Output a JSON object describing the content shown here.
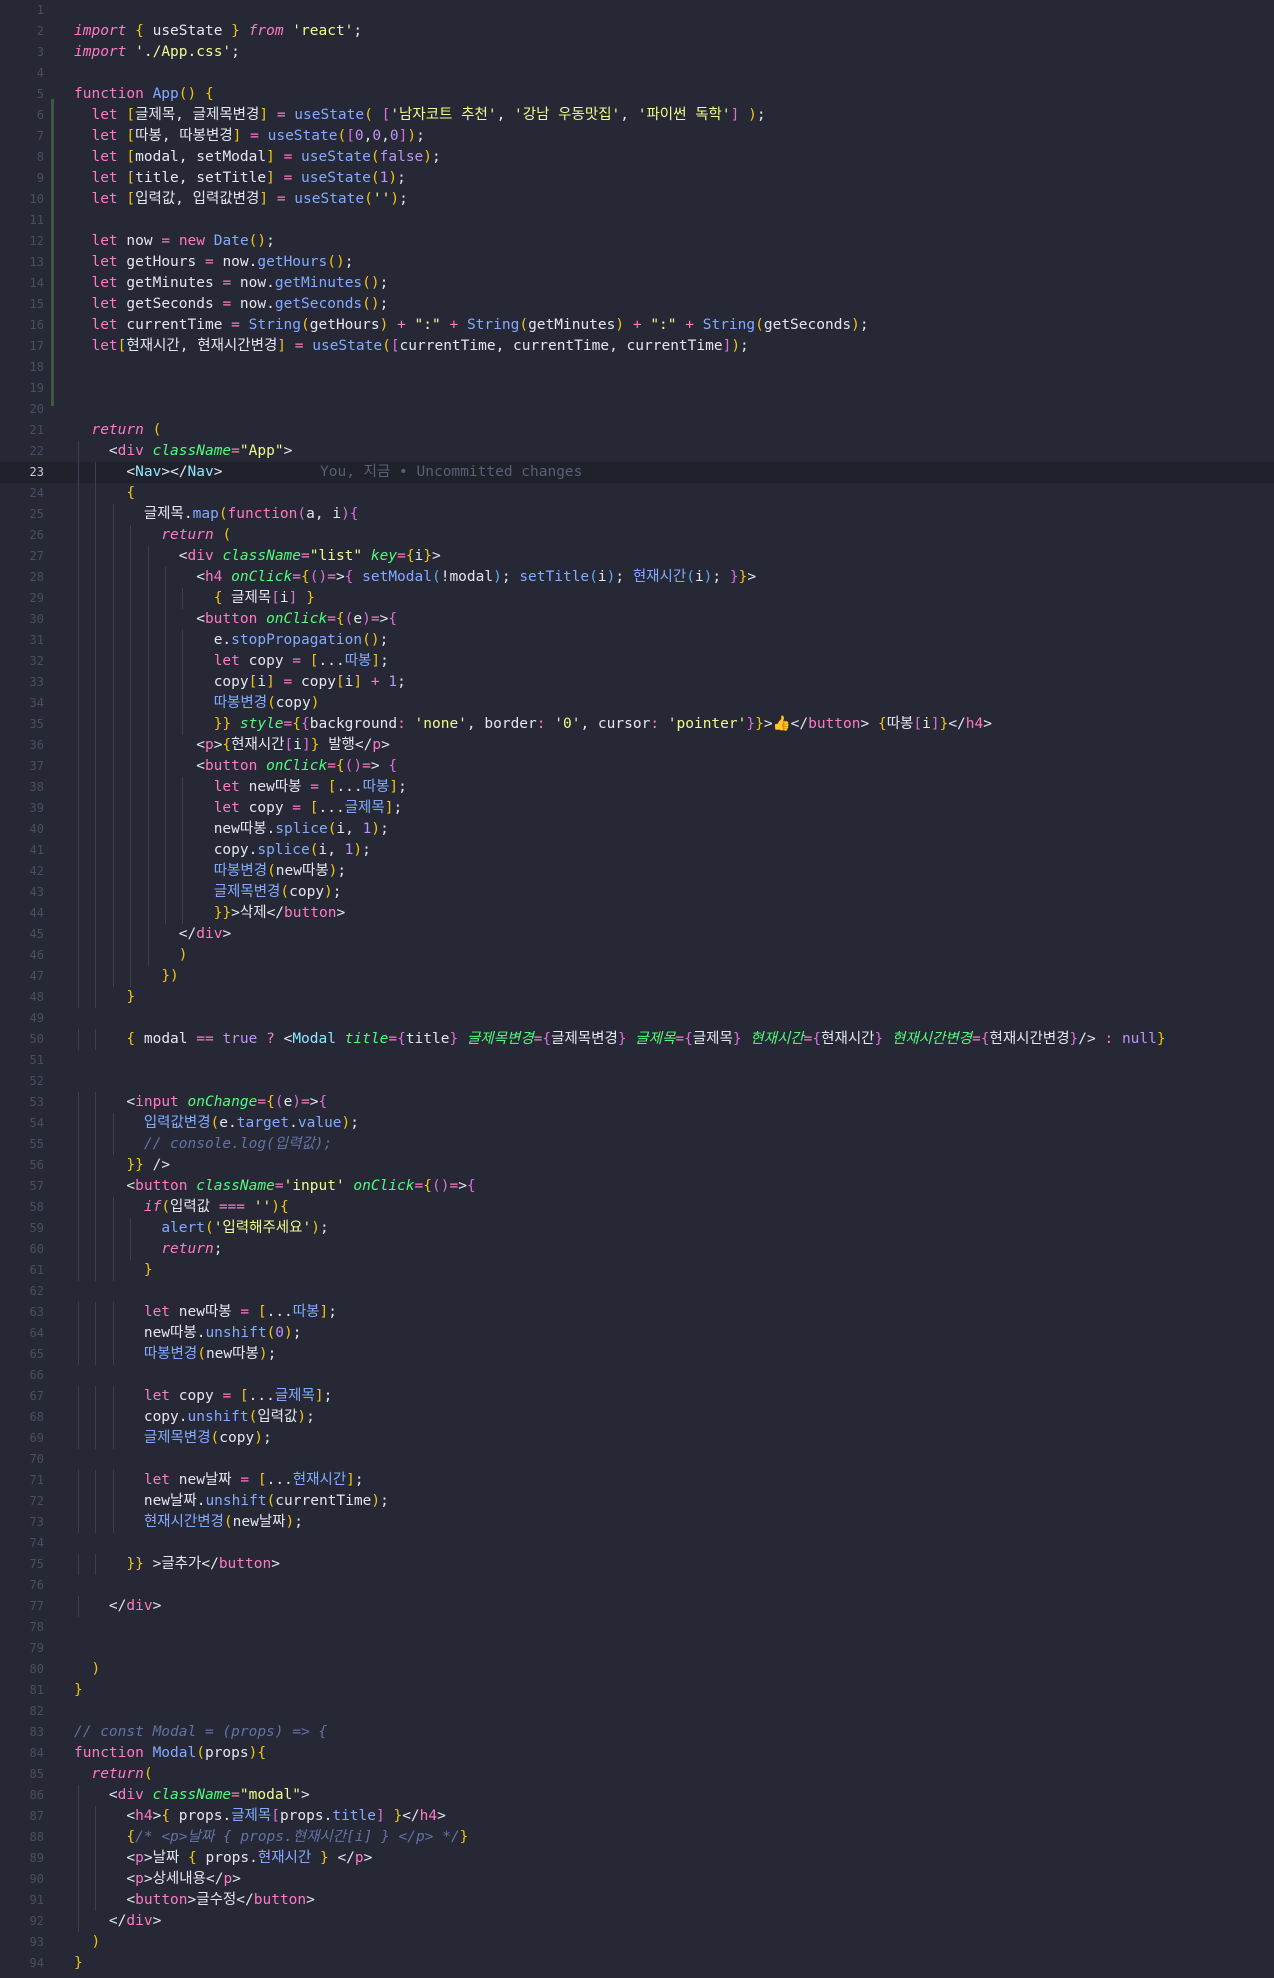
{
  "editor": {
    "active_line": 23,
    "blame": "You, 지금 • Uncommitted changes",
    "lines": [
      {
        "n": 1,
        "t": ""
      },
      {
        "n": 2,
        "t": "import { useState } from 'react';"
      },
      {
        "n": 3,
        "t": "import './App.css';"
      },
      {
        "n": 4,
        "t": ""
      },
      {
        "n": 5,
        "t": "function App() {"
      },
      {
        "n": 6,
        "t": "  let [글제목, 글제목변경] = useState( ['남자코트 추천', '강남 우동맛집', '파이썬 독학'] );"
      },
      {
        "n": 7,
        "t": "  let [따봉, 따봉변경] = useState([0,0,0]);"
      },
      {
        "n": 8,
        "t": "  let [modal, setModal] = useState(false);"
      },
      {
        "n": 9,
        "t": "  let [title, setTitle] = useState(1);"
      },
      {
        "n": 10,
        "t": "  let [입력값, 입력값변경] = useState('');"
      },
      {
        "n": 11,
        "t": ""
      },
      {
        "n": 12,
        "t": "  let now = new Date();"
      },
      {
        "n": 13,
        "t": "  let getHours = now.getHours();"
      },
      {
        "n": 14,
        "t": "  let getMinutes = now.getMinutes();"
      },
      {
        "n": 15,
        "t": "  let getSeconds = now.getSeconds();"
      },
      {
        "n": 16,
        "t": "  let currentTime = String(getHours) + \":\" + String(getMinutes) + \":\" + String(getSeconds);"
      },
      {
        "n": 17,
        "t": "  let[현재시간, 현재시간변경] = useState([currentTime, currentTime, currentTime]);"
      },
      {
        "n": 18,
        "t": ""
      },
      {
        "n": 19,
        "t": ""
      },
      {
        "n": 20,
        "t": ""
      },
      {
        "n": 21,
        "t": "  return ("
      },
      {
        "n": 22,
        "t": "    <div className=\"App\">"
      },
      {
        "n": 23,
        "t": "      <Nav></Nav>"
      },
      {
        "n": 24,
        "t": "      {"
      },
      {
        "n": 25,
        "t": "        글제목.map(function(a, i){"
      },
      {
        "n": 26,
        "t": "          return ("
      },
      {
        "n": 27,
        "t": "            <div className=\"list\" key={i}>"
      },
      {
        "n": 28,
        "t": "              <h4 onClick={()=>{ setModal(!modal); setTitle(i); 현재시간(i); }}>"
      },
      {
        "n": 29,
        "t": "                { 글제목[i] }"
      },
      {
        "n": 30,
        "t": "              <button onClick={(e)=>{"
      },
      {
        "n": 31,
        "t": "                e.stopPropagation();"
      },
      {
        "n": 32,
        "t": "                let copy = [...따봉];"
      },
      {
        "n": 33,
        "t": "                copy[i] = copy[i] + 1;"
      },
      {
        "n": 34,
        "t": "                따봉변경(copy)"
      },
      {
        "n": 35,
        "t": "                }} style={{background: 'none', border: '0', cursor: 'pointer'}}>👍</button> {따봉[i]}</h4>"
      },
      {
        "n": 36,
        "t": "              <p>{현재시간[i]} 발행</p>"
      },
      {
        "n": 37,
        "t": "              <button onClick={()=> {"
      },
      {
        "n": 38,
        "t": "                let new따봉 = [...따봉];"
      },
      {
        "n": 39,
        "t": "                let copy = [...글제목];"
      },
      {
        "n": 40,
        "t": "                new따봉.splice(i, 1);"
      },
      {
        "n": 41,
        "t": "                copy.splice(i, 1);"
      },
      {
        "n": 42,
        "t": "                따봉변경(new따봉);"
      },
      {
        "n": 43,
        "t": "                글제목변경(copy);"
      },
      {
        "n": 44,
        "t": "                }}>삭제</button>"
      },
      {
        "n": 45,
        "t": "            </div>"
      },
      {
        "n": 46,
        "t": "            )"
      },
      {
        "n": 47,
        "t": "          })"
      },
      {
        "n": 48,
        "t": "      }"
      },
      {
        "n": 49,
        "t": ""
      },
      {
        "n": 50,
        "t": "      { modal == true ? <Modal title={title} 글제목변경={글제목변경} 글제목={글제목} 현재시간={현재시간} 현재시간변경={현재시간변경}/> : null}"
      },
      {
        "n": 51,
        "t": ""
      },
      {
        "n": 52,
        "t": ""
      },
      {
        "n": 53,
        "t": "      <input onChange={(e)=>{"
      },
      {
        "n": 54,
        "t": "        입력값변경(e.target.value);"
      },
      {
        "n": 55,
        "t": "        // console.log(입력값);"
      },
      {
        "n": 56,
        "t": "      }} />"
      },
      {
        "n": 57,
        "t": "      <button className='input' onClick={()=>{"
      },
      {
        "n": 58,
        "t": "        if(입력값 === ''){"
      },
      {
        "n": 59,
        "t": "          alert('입력해주세요');"
      },
      {
        "n": 60,
        "t": "          return;"
      },
      {
        "n": 61,
        "t": "        }"
      },
      {
        "n": 62,
        "t": ""
      },
      {
        "n": 63,
        "t": "        let new따봉 = [...따봉];"
      },
      {
        "n": 64,
        "t": "        new따봉.unshift(0);"
      },
      {
        "n": 65,
        "t": "        따봉변경(new따봉);"
      },
      {
        "n": 66,
        "t": ""
      },
      {
        "n": 67,
        "t": "        let copy = [...글제목];"
      },
      {
        "n": 68,
        "t": "        copy.unshift(입력값);"
      },
      {
        "n": 69,
        "t": "        글제목변경(copy);"
      },
      {
        "n": 70,
        "t": ""
      },
      {
        "n": 71,
        "t": "        let new날짜 = [...현재시간];"
      },
      {
        "n": 72,
        "t": "        new날짜.unshift(currentTime);"
      },
      {
        "n": 73,
        "t": "        현재시간변경(new날짜);"
      },
      {
        "n": 74,
        "t": ""
      },
      {
        "n": 75,
        "t": "      }} >글추가</button>"
      },
      {
        "n": 76,
        "t": ""
      },
      {
        "n": 77,
        "t": "    </div>"
      },
      {
        "n": 78,
        "t": ""
      },
      {
        "n": 79,
        "t": ""
      },
      {
        "n": 80,
        "t": "  )"
      },
      {
        "n": 81,
        "t": "}"
      },
      {
        "n": 82,
        "t": ""
      },
      {
        "n": 83,
        "t": "// const Modal = (props) => {"
      },
      {
        "n": 84,
        "t": "function Modal(props){"
      },
      {
        "n": 85,
        "t": "  return("
      },
      {
        "n": 86,
        "t": "    <div className=\"modal\">"
      },
      {
        "n": 87,
        "t": "      <h4>{ props.글제목[props.title] }</h4>"
      },
      {
        "n": 88,
        "t": "      {/* <p>날짜 { props.현재시간[i] } </p> */}"
      },
      {
        "n": 89,
        "t": "      <p>날짜 { props.현재시간 } </p>"
      },
      {
        "n": 90,
        "t": "      <p>상세내용</p>"
      },
      {
        "n": 91,
        "t": "      <button>글수정</button>"
      },
      {
        "n": 92,
        "t": "    </div>"
      },
      {
        "n": 93,
        "t": "  )"
      },
      {
        "n": 94,
        "t": "}"
      }
    ]
  },
  "colors": {
    "background": "#262835",
    "keyword": "#ff79c6",
    "string": "#f1fa8c",
    "function": "#82aaff",
    "attribute": "#50fa7b",
    "comment": "#6272a4",
    "component": "#8be9fd",
    "number": "#bd93f9"
  }
}
